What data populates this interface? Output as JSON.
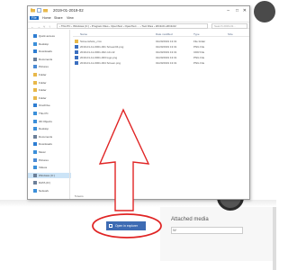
{
  "window": {
    "title": "2019-01-2019-02"
  },
  "ribbon": {
    "tabs": [
      {
        "label": "File",
        "active": true
      },
      {
        "label": "Home",
        "active": false
      },
      {
        "label": "Share",
        "active": false
      },
      {
        "label": "View",
        "active": false
      }
    ]
  },
  "address_bar": {
    "path": "› This PC › Windows (C:) › Program Files › OpenText › OpenText ... › Tool Files › 2019-01-2019-02",
    "search_placeholder": "Search 2019-01..."
  },
  "nav": {
    "items": [
      {
        "label": "Quick access",
        "icon": "star-icon",
        "color": "#2d7dd2"
      },
      {
        "label": "Desktop",
        "icon": "desktop-icon",
        "color": "#3b8fd9"
      },
      {
        "label": "Downloads",
        "icon": "download-icon",
        "color": "#2d7dd2"
      },
      {
        "label": "Documents",
        "icon": "documents-icon",
        "color": "#6b7f99"
      },
      {
        "label": "Pictures",
        "icon": "pictures-icon",
        "color": "#4a8ad4"
      },
      {
        "label": "Folder",
        "icon": "folder-icon",
        "color": "#e8b84a"
      },
      {
        "label": "Folder",
        "icon": "folder-icon",
        "color": "#e8b84a"
      },
      {
        "label": "Folder",
        "icon": "folder-icon",
        "color": "#e8b84a"
      },
      {
        "label": "Folder",
        "icon": "folder-icon",
        "color": "#e8b84a"
      },
      {
        "label": "OneDrive",
        "icon": "cloud-icon",
        "color": "#2d7dd2"
      },
      {
        "label": "This PC",
        "icon": "computer-icon",
        "color": "#3b8fd9"
      },
      {
        "label": "3D Objects",
        "icon": "cube-icon",
        "color": "#3b8fd9"
      },
      {
        "label": "Desktop",
        "icon": "desktop-icon",
        "color": "#3b8fd9"
      },
      {
        "label": "Documents",
        "icon": "documents-icon",
        "color": "#6b7f99"
      },
      {
        "label": "Downloads",
        "icon": "download-icon",
        "color": "#2d7dd2"
      },
      {
        "label": "Music",
        "icon": "music-icon",
        "color": "#3b8fd9"
      },
      {
        "label": "Pictures",
        "icon": "pictures-icon",
        "color": "#4a8ad4"
      },
      {
        "label": "Videos",
        "icon": "video-icon",
        "color": "#3b8fd9"
      },
      {
        "label": "Windows (C:)",
        "icon": "drive-icon",
        "color": "#6b7f99",
        "selected": true
      },
      {
        "label": "DATA (D:)",
        "icon": "drive-icon",
        "color": "#6b7f99"
      },
      {
        "label": "Network",
        "icon": "network-icon",
        "color": "#3b8fd9"
      }
    ]
  },
  "columns": [
    "Name",
    "Date modified",
    "Type",
    "Size"
  ],
  "files": [
    {
      "name": "Screenshots_cmx",
      "date": "01/20/2019 13:31",
      "type": "File folder",
      "size": "",
      "icon": "folder-icon",
      "color": "#e8b84a"
    },
    {
      "name": "2019-01-11-0001-001 Screen04.png",
      "date": "01/20/2019 13:31",
      "type": "PNG File",
      "size": "",
      "icon": "image-file-icon",
      "color": "#3b6fbf"
    },
    {
      "name": "2019-01-11-0001-002 cdr.cdr",
      "date": "01/20/2019 13:31",
      "type": "CDR File",
      "size": "",
      "icon": "image-file-icon",
      "color": "#3b6fbf"
    },
    {
      "name": "2019-01-11-0001-003 logo.png",
      "date": "01/20/2019 13:31",
      "type": "PNG File",
      "size": "",
      "icon": "image-file-icon",
      "color": "#3b6fbf"
    },
    {
      "name": "2019-01-11-0001-004 Screen.png",
      "date": "01/20/2019 13:31",
      "type": "PNG File",
      "size": "",
      "icon": "image-file-icon",
      "color": "#3b6fbf"
    }
  ],
  "status": "5 items",
  "bottom_button": {
    "label": "Open in explorer"
  },
  "right_panel": {
    "title": "Attached media",
    "input_value": "W"
  },
  "colors": {
    "annotation": "#e02424",
    "accent": "#1e6cc4",
    "button": "#3d6bb3"
  }
}
